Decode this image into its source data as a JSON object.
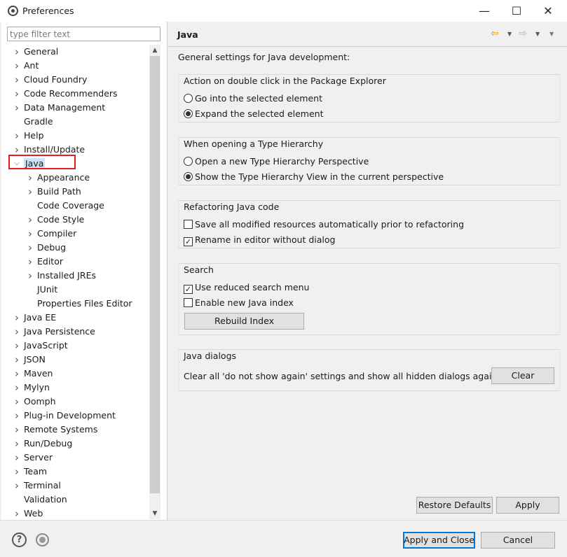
{
  "window": {
    "title": "Preferences",
    "controls": {
      "minimize": "—",
      "maximize": "☐",
      "close": "✕"
    }
  },
  "filter": {
    "placeholder": "type filter text",
    "value": ""
  },
  "tree": [
    {
      "label": "General",
      "expandable": true,
      "expanded": false,
      "indent": 0
    },
    {
      "label": "Ant",
      "expandable": true,
      "expanded": false,
      "indent": 0
    },
    {
      "label": "Cloud Foundry",
      "expandable": true,
      "expanded": false,
      "indent": 0
    },
    {
      "label": "Code Recommenders",
      "expandable": true,
      "expanded": false,
      "indent": 0
    },
    {
      "label": "Data Management",
      "expandable": true,
      "expanded": false,
      "indent": 0
    },
    {
      "label": "Gradle",
      "expandable": false,
      "expanded": false,
      "indent": 0
    },
    {
      "label": "Help",
      "expandable": true,
      "expanded": false,
      "indent": 0
    },
    {
      "label": "Install/Update",
      "expandable": true,
      "expanded": false,
      "indent": 0
    },
    {
      "label": "Java",
      "expandable": true,
      "expanded": true,
      "indent": 0,
      "selected": true
    },
    {
      "label": "Appearance",
      "expandable": true,
      "expanded": false,
      "indent": 1
    },
    {
      "label": "Build Path",
      "expandable": true,
      "expanded": false,
      "indent": 1
    },
    {
      "label": "Code Coverage",
      "expandable": false,
      "expanded": false,
      "indent": 1
    },
    {
      "label": "Code Style",
      "expandable": true,
      "expanded": false,
      "indent": 1
    },
    {
      "label": "Compiler",
      "expandable": true,
      "expanded": false,
      "indent": 1
    },
    {
      "label": "Debug",
      "expandable": true,
      "expanded": false,
      "indent": 1
    },
    {
      "label": "Editor",
      "expandable": true,
      "expanded": false,
      "indent": 1
    },
    {
      "label": "Installed JREs",
      "expandable": true,
      "expanded": false,
      "indent": 1
    },
    {
      "label": "JUnit",
      "expandable": false,
      "expanded": false,
      "indent": 1
    },
    {
      "label": "Properties Files Editor",
      "expandable": false,
      "expanded": false,
      "indent": 1
    },
    {
      "label": "Java EE",
      "expandable": true,
      "expanded": false,
      "indent": 0
    },
    {
      "label": "Java Persistence",
      "expandable": true,
      "expanded": false,
      "indent": 0
    },
    {
      "label": "JavaScript",
      "expandable": true,
      "expanded": false,
      "indent": 0
    },
    {
      "label": "JSON",
      "expandable": true,
      "expanded": false,
      "indent": 0
    },
    {
      "label": "Maven",
      "expandable": true,
      "expanded": false,
      "indent": 0
    },
    {
      "label": "Mylyn",
      "expandable": true,
      "expanded": false,
      "indent": 0
    },
    {
      "label": "Oomph",
      "expandable": true,
      "expanded": false,
      "indent": 0
    },
    {
      "label": "Plug-in Development",
      "expandable": true,
      "expanded": false,
      "indent": 0
    },
    {
      "label": "Remote Systems",
      "expandable": true,
      "expanded": false,
      "indent": 0
    },
    {
      "label": "Run/Debug",
      "expandable": true,
      "expanded": false,
      "indent": 0
    },
    {
      "label": "Server",
      "expandable": true,
      "expanded": false,
      "indent": 0
    },
    {
      "label": "Team",
      "expandable": true,
      "expanded": false,
      "indent": 0
    },
    {
      "label": "Terminal",
      "expandable": true,
      "expanded": false,
      "indent": 0
    },
    {
      "label": "Validation",
      "expandable": false,
      "expanded": false,
      "indent": 0
    },
    {
      "label": "Web",
      "expandable": true,
      "expanded": false,
      "indent": 0
    }
  ],
  "page": {
    "title": "Java",
    "description": "General settings for Java development:",
    "double_click": {
      "title": "Action on double click in the Package Explorer",
      "opt1": "Go into the selected element",
      "opt2": "Expand the selected element",
      "selected": 2
    },
    "type_hierarchy": {
      "title": "When opening a Type Hierarchy",
      "opt1": "Open a new Type Hierarchy Perspective",
      "opt2": "Show the Type Hierarchy View in the current perspective",
      "selected": 2
    },
    "refactoring": {
      "title": "Refactoring Java code",
      "opt1": "Save all modified resources automatically prior to refactoring",
      "opt1_checked": false,
      "opt2": "Rename in editor without dialog",
      "opt2_checked": true
    },
    "search": {
      "title": "Search",
      "opt1": "Use reduced search menu",
      "opt1_checked": true,
      "opt2": "Enable new Java index",
      "opt2_checked": false,
      "rebuild_label": "Rebuild Index"
    },
    "dialogs": {
      "title": "Java dialogs",
      "text": "Clear all 'do not show again' settings and show all hidden dialogs again",
      "clear_label": "Clear"
    },
    "restore_label": "Restore Defaults",
    "apply_label": "Apply"
  },
  "footer": {
    "apply_close_label": "Apply and Close",
    "cancel_label": "Cancel"
  },
  "colors": {
    "selection_outline": "#e02020",
    "selection_bg": "#cce4f7",
    "nav_back_arrow": "#d6a000",
    "default_button_border": "#0078d7"
  }
}
